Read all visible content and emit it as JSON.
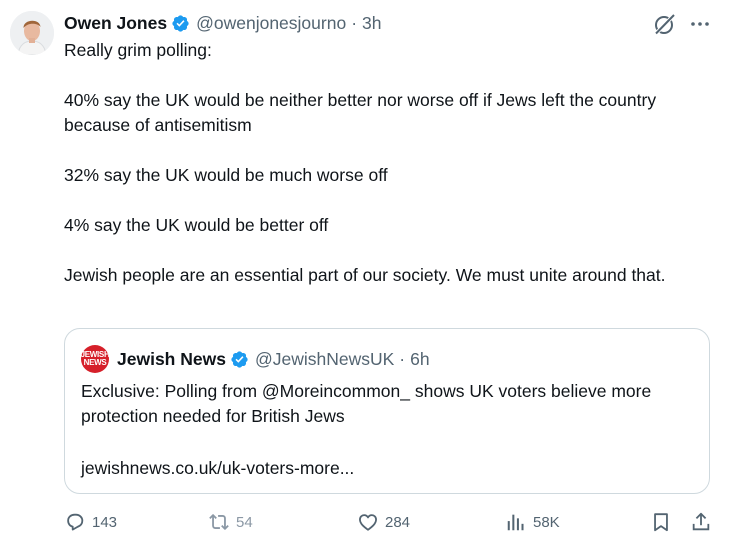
{
  "author": {
    "name": "Owen Jones",
    "handle": "@owenjonesjourno",
    "separator": "·",
    "time": "3h"
  },
  "tweet": {
    "paragraphs": [
      "Really grim polling:",
      "40% say the UK would be neither better nor worse off if Jews left the country because of antisemitism",
      "32% say the UK would be much worse off",
      "4% say the UK would be better off",
      "Jewish people are an essential part of our society. We must unite around that."
    ]
  },
  "quote": {
    "logo_line1": "JEWISH",
    "logo_line2": "NEWS",
    "name": "Jewish News",
    "handle": "@JewishNewsUK",
    "separator": "·",
    "time": "6h",
    "text": "Exclusive: Polling from @Moreincommon_ shows UK voters believe more protection needed for British Jews",
    "link": "jewishnews.co.uk/uk-voters-more..."
  },
  "actions": {
    "replies": "143",
    "reposts": "54",
    "likes": "284",
    "views": "58K"
  },
  "colors": {
    "text": "#0f1419",
    "secondary": "#536471",
    "verified": "#1d9bf0",
    "border": "#cfd9de",
    "repost_icon": "#8b98a5"
  },
  "icons": {
    "grok": "grok-icon",
    "more": "more-icon",
    "reply": "reply-icon",
    "repost": "repost-icon",
    "like": "heart-icon",
    "views": "views-icon",
    "bookmark": "bookmark-icon",
    "share": "share-icon"
  }
}
